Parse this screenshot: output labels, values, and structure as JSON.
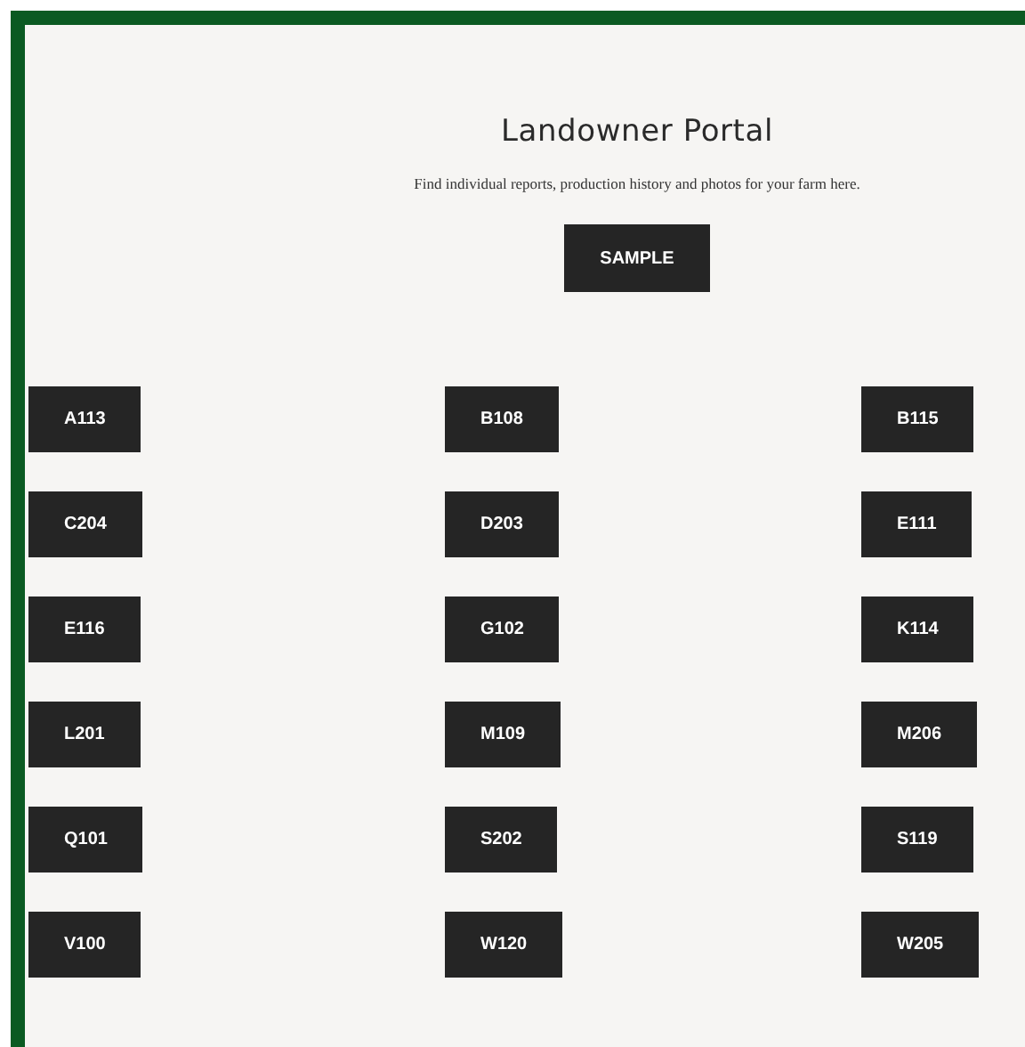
{
  "header": {
    "title": "Landowner Portal",
    "subtitle": "Find individual reports, production history and photos for your farm here.",
    "sample_button": "SAMPLE"
  },
  "farm_buttons": [
    "A113",
    "B108",
    "B115",
    "C204",
    "D203",
    "E111",
    "E116",
    "G102",
    "K114",
    "L201",
    "M109",
    "M206",
    "Q101",
    "S202",
    "S119",
    "V100",
    "W120",
    "W205"
  ]
}
